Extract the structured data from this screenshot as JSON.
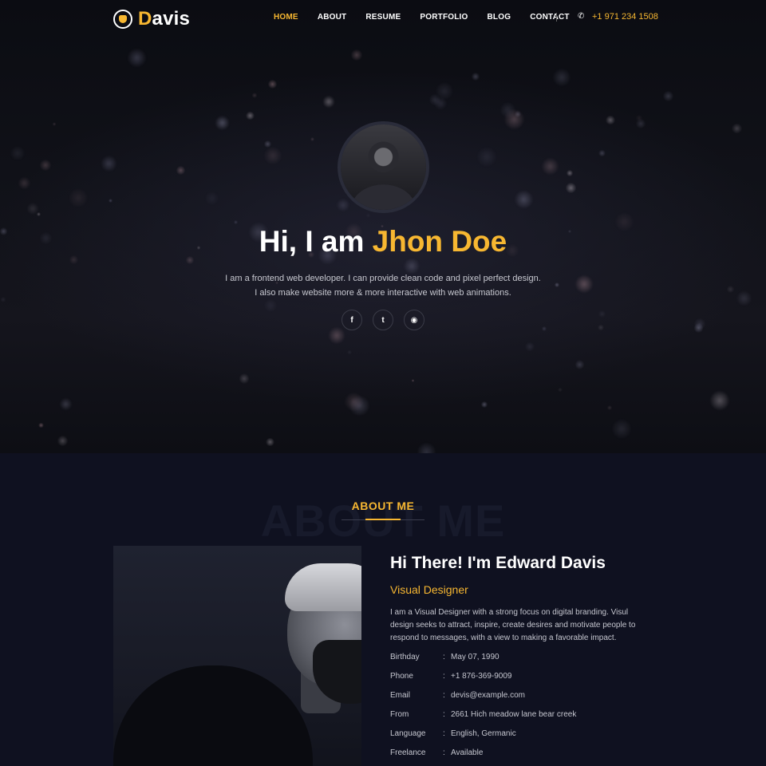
{
  "brand": {
    "first_letter": "D",
    "rest": "avis"
  },
  "nav": {
    "items": [
      {
        "label": "HOME",
        "active": true
      },
      {
        "label": "ABOUT",
        "active": false
      },
      {
        "label": "RESUME",
        "active": false
      },
      {
        "label": "PORTFOLIO",
        "active": false
      },
      {
        "label": "BLOG",
        "active": false
      },
      {
        "label": "CONTACT",
        "active": false
      }
    ],
    "phone": "+1 971 234 1508"
  },
  "hero": {
    "greeting": "Hi, I am ",
    "name": "Jhon Doe",
    "desc_line1": "I am a frontend web developer. I can provide clean code and pixel perfect design.",
    "desc_line2": "I also make website more & more interactive with web animations.",
    "socials": [
      {
        "icon": "facebook-icon",
        "glyph": "f"
      },
      {
        "icon": "twitter-icon",
        "glyph": "t"
      },
      {
        "icon": "github-icon",
        "glyph": "◉"
      }
    ]
  },
  "about": {
    "bg_title": "ABOUT ME",
    "title": "ABOUT ME",
    "name": "Hi There! I'm Edward Davis",
    "role": "Visual Designer",
    "desc": "I am a Visual Designer with a strong focus on digital branding. Visul design seeks to attract, inspire, create desires and motivate people to respond to messages, with a view to making a favorable impact.",
    "info": [
      {
        "key": "Birthday",
        "value": "May 07, 1990"
      },
      {
        "key": "Phone",
        "value": "+1 876-369-9009"
      },
      {
        "key": "Email",
        "value": "devis@example.com"
      },
      {
        "key": "From",
        "value": "2661 Hich meadow lane bear creek"
      },
      {
        "key": "Language",
        "value": "English, Germanic"
      },
      {
        "key": "Freelance",
        "value": "Available"
      }
    ]
  },
  "colors": {
    "accent": "#f7b731",
    "background": "#0f1120"
  }
}
